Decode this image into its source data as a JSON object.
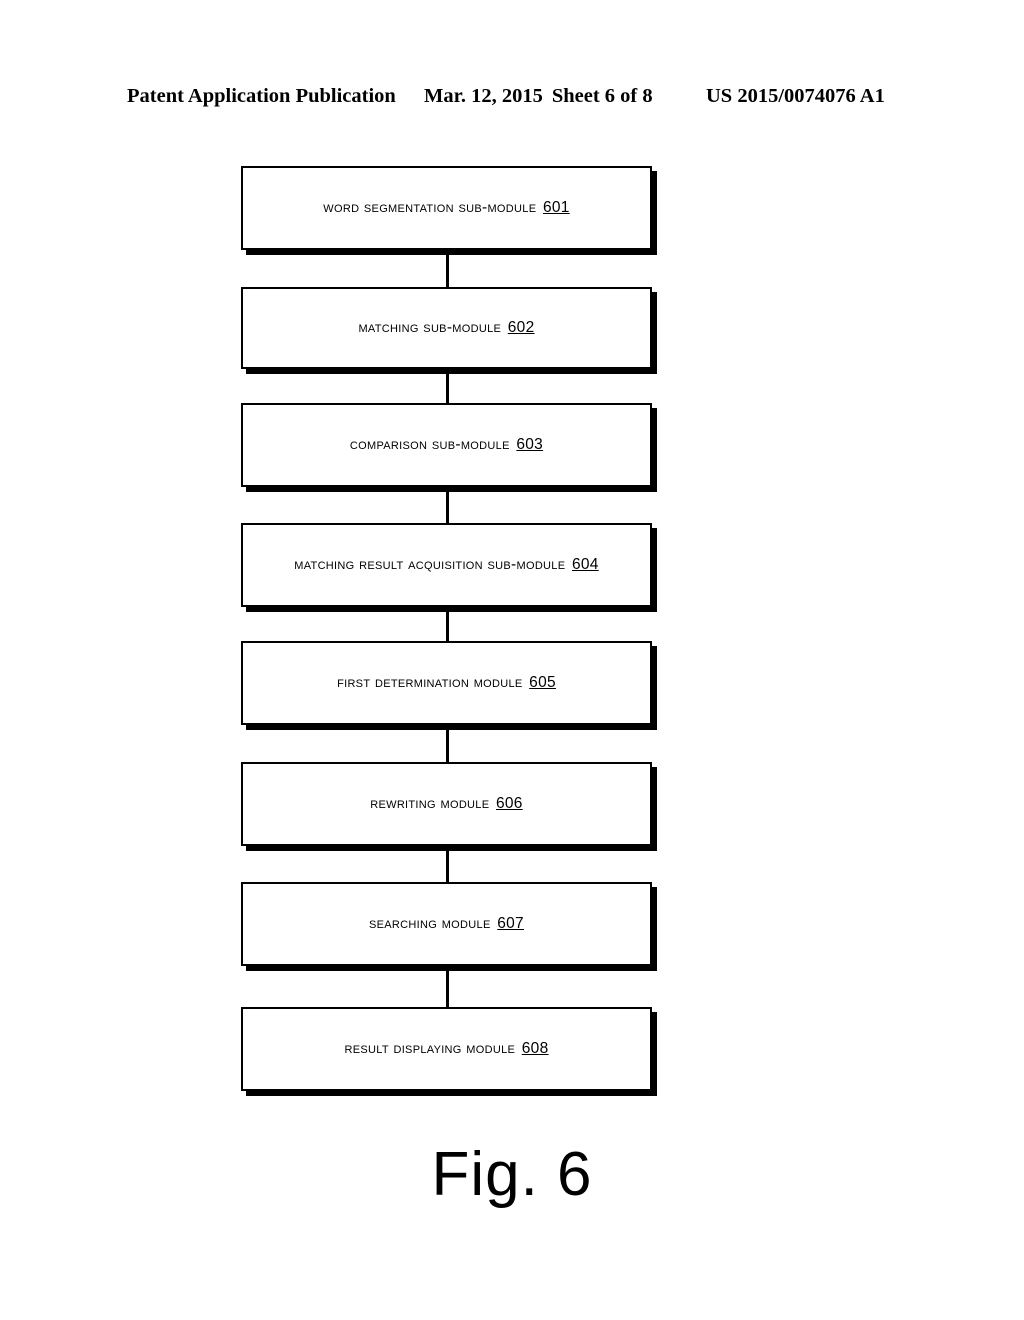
{
  "header": {
    "publication": "Patent Application Publication",
    "date": "Mar. 12, 2015",
    "sheet": "Sheet 6 of 8",
    "patent_number": "US 2015/0074076 A1"
  },
  "figure": {
    "caption": "Fig. 6"
  },
  "chart_data": {
    "type": "diagram",
    "diagram_type": "vertical-flowchart",
    "title": "Fig. 6",
    "orientation": "top-to-bottom",
    "connector_style": "plain-line",
    "node_count": 8,
    "nodes": [
      {
        "id": "601",
        "text": "Word segmentation sub-module",
        "ref": "601",
        "full": "Word segmentation sub-module 601"
      },
      {
        "id": "602",
        "text": "Matching sub-module",
        "ref": "602",
        "full": "Matching sub-module 602"
      },
      {
        "id": "603",
        "text": "Comparison sub-module",
        "ref": "603",
        "full": "Comparison sub-module 603"
      },
      {
        "id": "604",
        "text": "Matching result acquisition sub-module",
        "ref": "604",
        "full": "Matching result acquisition sub-module 604"
      },
      {
        "id": "605",
        "text": "First determination module",
        "ref": "605",
        "full": "First determination module 605"
      },
      {
        "id": "606",
        "text": "Rewriting module",
        "ref": "606",
        "full": "Rewriting module 606"
      },
      {
        "id": "607",
        "text": "Searching module",
        "ref": "607",
        "full": "Searching module 607"
      },
      {
        "id": "608",
        "text": "Result displaying module",
        "ref": "608",
        "full": "Result displaying module 608"
      }
    ],
    "edges": [
      {
        "from": "601",
        "to": "602"
      },
      {
        "from": "602",
        "to": "603"
      },
      {
        "from": "603",
        "to": "604"
      },
      {
        "from": "604",
        "to": "605"
      },
      {
        "from": "605",
        "to": "606"
      },
      {
        "from": "606",
        "to": "607"
      },
      {
        "from": "607",
        "to": "608"
      }
    ],
    "colors": {
      "stroke": "#000000",
      "fill": "#ffffff",
      "shadow": "#000000",
      "background": "#ffffff"
    }
  }
}
